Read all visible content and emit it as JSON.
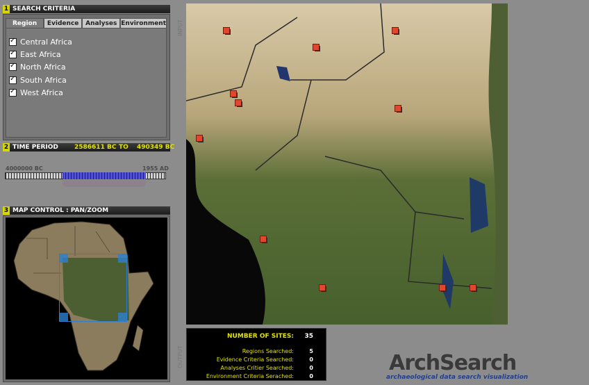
{
  "search_criteria": {
    "number": "1",
    "title": "SEARCH CRITERIA",
    "tabs": [
      {
        "label": "Region"
      },
      {
        "label": "Evidence"
      },
      {
        "label": "Analyses"
      },
      {
        "label": "Environment"
      }
    ],
    "active_tab": "Region",
    "regions": [
      {
        "label": "Central Africa",
        "checked": true
      },
      {
        "label": "East Africa",
        "checked": true
      },
      {
        "label": "North Africa",
        "checked": true
      },
      {
        "label": "South Africa",
        "checked": true
      },
      {
        "label": "West Africa",
        "checked": true
      }
    ]
  },
  "time_period": {
    "number": "2",
    "title": "TIME PERIOD",
    "from": "2586611 BC",
    "to_label": "TO",
    "to": "490349 BC",
    "min_label": "4000000 BC",
    "max_label": "1955 AD"
  },
  "map_control": {
    "number": "3",
    "title": "MAP CONTROL : PAN/ZOOM"
  },
  "side_labels": {
    "input": "INPUT",
    "output": "OUTPUT"
  },
  "output": {
    "number_of_sites_label": "NUMBER OF SITES:",
    "number_of_sites": "35",
    "rows": [
      {
        "label": "Regions Searched:",
        "value": "5"
      },
      {
        "label": "Evidence Criteria Searched:",
        "value": "0"
      },
      {
        "label": "Analyses Critier Searched:",
        "value": "0"
      },
      {
        "label": "Environment Criteria Serached:",
        "value": "0"
      }
    ]
  },
  "logo": {
    "title": "ArchSearch",
    "subtitle": "archaeological data search visualization"
  },
  "colors": {
    "accent_yellow": "#e2e200",
    "marker_red": "#e2462c",
    "slider_blue": "#4f4fe0",
    "logo_blue": "#243f8a"
  }
}
